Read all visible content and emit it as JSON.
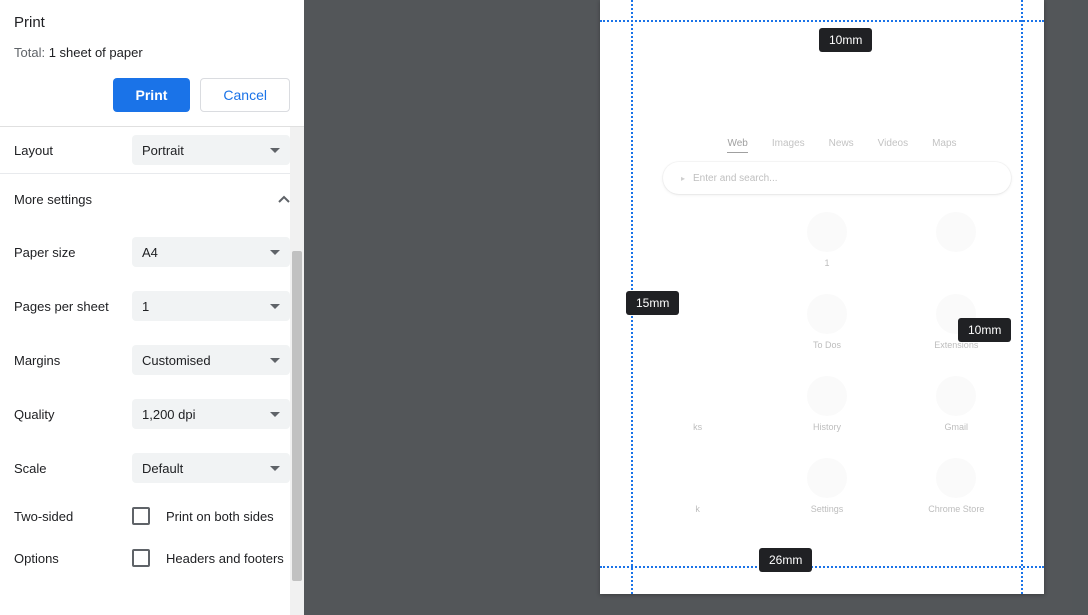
{
  "header": {
    "title": "Print",
    "total_prefix": "Total: ",
    "total_value": "1 sheet of paper",
    "print_btn": "Print",
    "cancel_btn": "Cancel"
  },
  "settings": {
    "layout": {
      "label": "Layout",
      "value": "Portrait"
    },
    "more": "More settings",
    "paper_size": {
      "label": "Paper size",
      "value": "A4"
    },
    "pages_per_sheet": {
      "label": "Pages per sheet",
      "value": "1"
    },
    "margins": {
      "label": "Margins",
      "value": "Customised"
    },
    "quality": {
      "label": "Quality",
      "value": "1,200 dpi"
    },
    "scale": {
      "label": "Scale",
      "value": "Default"
    },
    "two_sided": {
      "label": "Two-sided",
      "option": "Print on both sides"
    },
    "options": {
      "label": "Options",
      "option": "Headers and footers"
    }
  },
  "margin_values": {
    "top": "10mm",
    "left": "15mm",
    "right": "10mm",
    "bottom": "26mm"
  },
  "preview": {
    "tabs": [
      "Web",
      "Images",
      "News",
      "Videos",
      "Maps"
    ],
    "search_placeholder": "Enter and search...",
    "tiles": [
      "",
      "1",
      "",
      "",
      "To Dos",
      "Extensions",
      "ks",
      "History",
      "Gmail",
      "k",
      "Settings",
      "Chrome Store"
    ]
  }
}
